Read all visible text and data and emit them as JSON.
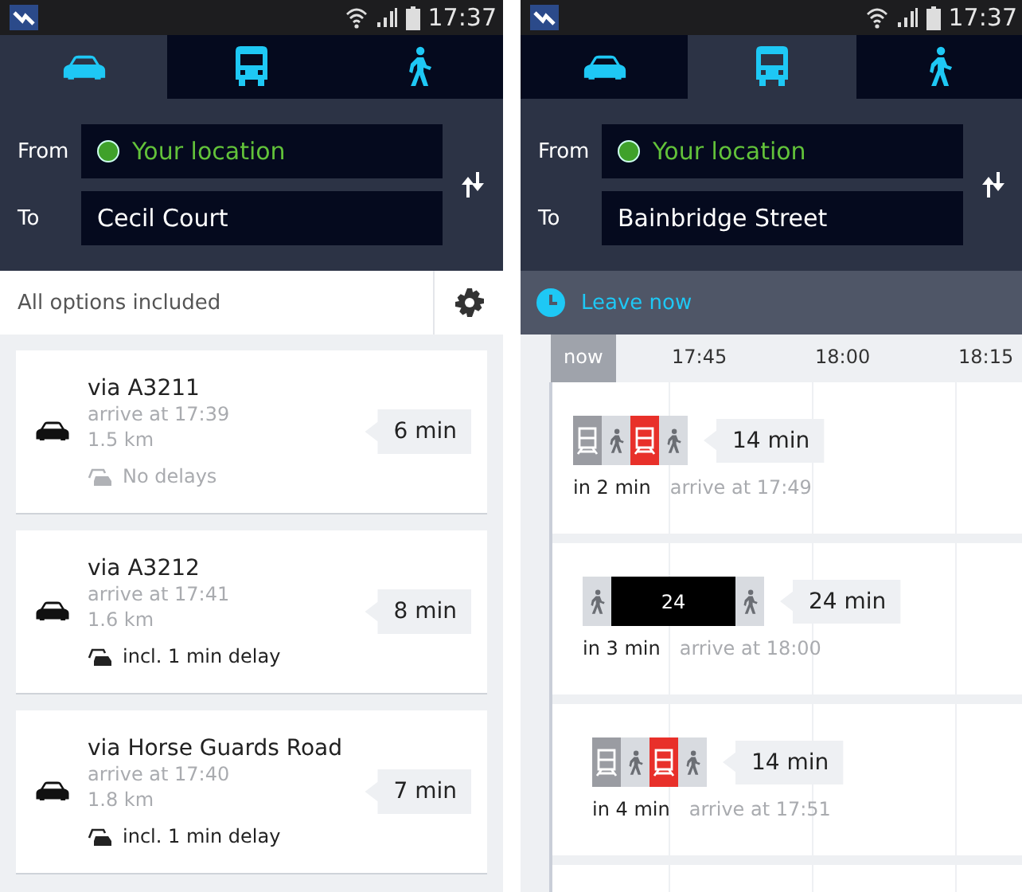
{
  "screens": [
    {
      "status": {
        "time": "17:37"
      },
      "tabs": [
        {
          "kind": "car",
          "selected": true
        },
        {
          "kind": "bus",
          "selected": false
        },
        {
          "kind": "walk",
          "selected": false
        }
      ],
      "from": {
        "label": "From",
        "value": "Your location"
      },
      "to": {
        "label": "To",
        "value": "Cecil Court"
      },
      "options": {
        "label": "All options included"
      },
      "routes": [
        {
          "title": "via A3211",
          "arrive": "arrive at 17:39",
          "distance": "1.5 km",
          "delay": "No delays",
          "delayed": false,
          "duration": "6 min"
        },
        {
          "title": "via A3212",
          "arrive": "arrive at 17:41",
          "distance": "1.6 km",
          "delay": "incl. 1 min delay",
          "delayed": true,
          "duration": "8 min"
        },
        {
          "title": "via Horse Guards Road",
          "arrive": "arrive at 17:40",
          "distance": "1.8 km",
          "delay": "incl. 1 min delay",
          "delayed": true,
          "duration": "7 min"
        }
      ]
    },
    {
      "status": {
        "time": "17:37"
      },
      "tabs": [
        {
          "kind": "car",
          "selected": false
        },
        {
          "kind": "bus",
          "selected": true
        },
        {
          "kind": "walk",
          "selected": false
        }
      ],
      "from": {
        "label": "From",
        "value": "Your location"
      },
      "to": {
        "label": "To",
        "value": "Bainbridge Street"
      },
      "leave": {
        "label": "Leave now"
      },
      "timeline": {
        "ticks": [
          "now",
          "17:45",
          "18:00",
          "18:15"
        ]
      },
      "trips": [
        {
          "segments": [
            {
              "kind": "train",
              "color": "#9a9ca2"
            },
            {
              "kind": "walk"
            },
            {
              "kind": "train",
              "color": "#e8302a"
            },
            {
              "kind": "walk"
            }
          ],
          "duration": "14 min",
          "departs": "in 2 min",
          "arrive": "arrive at 17:49"
        },
        {
          "segments": [
            {
              "kind": "walk"
            },
            {
              "kind": "bus",
              "label": "24"
            },
            {
              "kind": "walk"
            }
          ],
          "duration": "24 min",
          "departs": "in 3 min",
          "arrive": "arrive at 18:00"
        },
        {
          "segments": [
            {
              "kind": "train",
              "color": "#9a9ca2"
            },
            {
              "kind": "walk"
            },
            {
              "kind": "train",
              "color": "#e8302a"
            },
            {
              "kind": "walk"
            }
          ],
          "duration": "14 min",
          "departs": "in 4 min",
          "arrive": "arrive at 17:51"
        }
      ]
    }
  ]
}
